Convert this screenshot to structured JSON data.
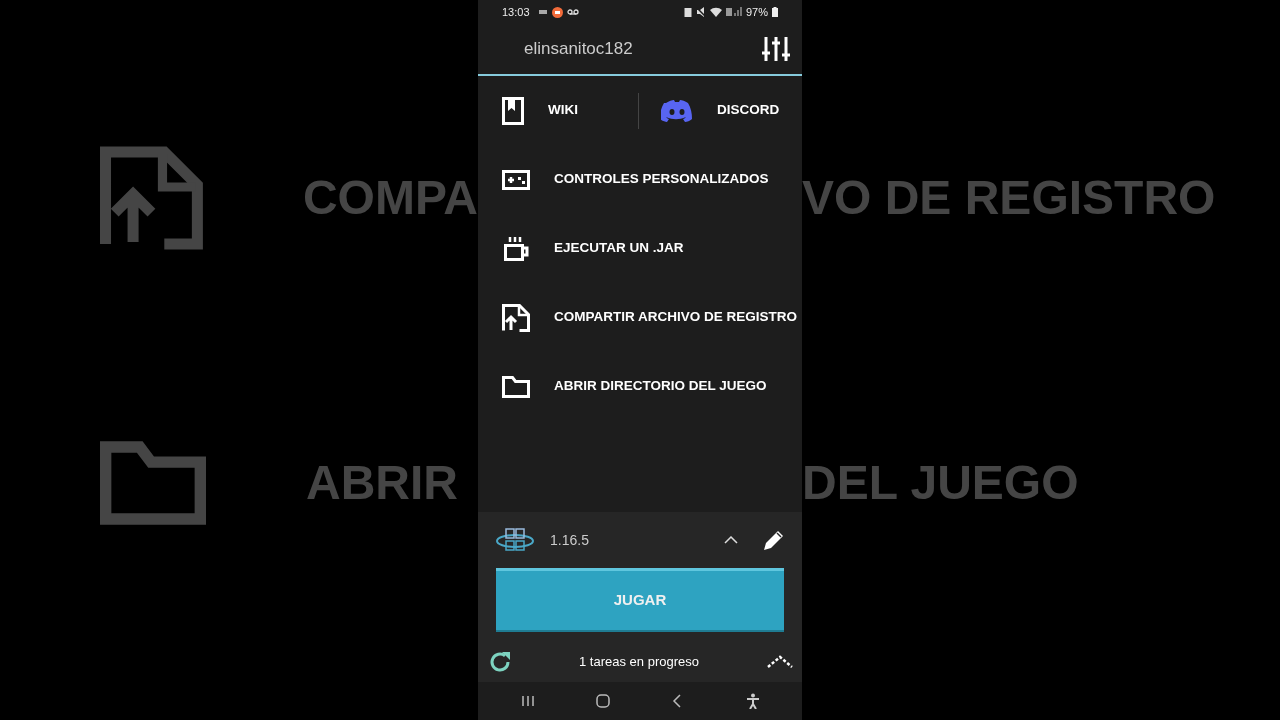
{
  "backdrop": {
    "left": [
      "COMPA",
      "ABRIR"
    ],
    "right": [
      "VO DE REGISTRO",
      "DEL JUEGO"
    ]
  },
  "status_bar": {
    "time": "13:03",
    "battery": "97%"
  },
  "header": {
    "username": "elinsanitoc182"
  },
  "links": [
    {
      "kind": "wiki",
      "label": "WIKI"
    },
    {
      "kind": "discord",
      "label": "DISCORD"
    }
  ],
  "menu": [
    {
      "kind": "controls",
      "label": "CONTROLES PERSONALIZADOS"
    },
    {
      "kind": "jar",
      "label": "EJECUTAR UN .JAR"
    },
    {
      "kind": "share",
      "label": "COMPARTIR ARCHIVO DE REGISTRO"
    },
    {
      "kind": "folder",
      "label": "ABRIR DIRECTORIO DEL JUEGO"
    }
  ],
  "version": {
    "label": "1.16.5",
    "expanded": false
  },
  "play_button": "JUGAR",
  "tasks": {
    "label": "1 tareas en progreso"
  }
}
